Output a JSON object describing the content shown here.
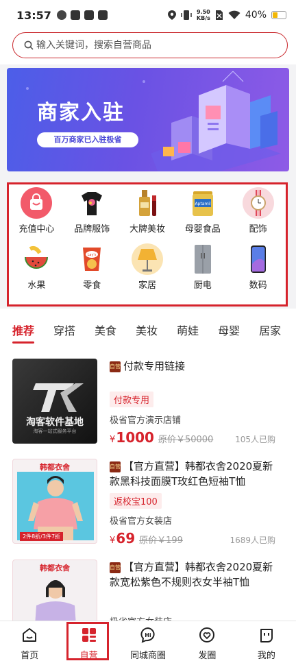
{
  "status_bar": {
    "time": "13:57",
    "speed_top": "9.50",
    "speed_bottom": "KB/s",
    "battery": "40%",
    "battery_level": 0.4
  },
  "search": {
    "placeholder": "输入关键词，搜索自营商品"
  },
  "banner": {
    "title": "商家入驻",
    "subtitle": "百万商家已入驻极省"
  },
  "categories": [
    {
      "label": "充值中心",
      "icon": "shopping-bag-icon",
      "color": "#f25a6a"
    },
    {
      "label": "品牌服饰",
      "icon": "tshirt-icon",
      "color": "#1c1c1c"
    },
    {
      "label": "大牌美妆",
      "icon": "perfume-icon",
      "color": "#d4a23a"
    },
    {
      "label": "母婴食品",
      "icon": "milk-powder-icon",
      "color": "#e7c24b"
    },
    {
      "label": "配饰",
      "icon": "watch-icon",
      "color": "#e1485a"
    },
    {
      "label": "水果",
      "icon": "watermelon-icon",
      "color": "#e24a3c"
    },
    {
      "label": "零食",
      "icon": "chips-icon",
      "color": "#e24a2a"
    },
    {
      "label": "家居",
      "icon": "lamp-icon",
      "color": "#f2b233"
    },
    {
      "label": "厨电",
      "icon": "fridge-icon",
      "color": "#9aa0a8"
    },
    {
      "label": "数码",
      "icon": "phone-icon",
      "color": "#5a7ee6"
    }
  ],
  "tabs": [
    "推荐",
    "穿搭",
    "美食",
    "美妆",
    "萌娃",
    "母婴",
    "居家"
  ],
  "products": [
    {
      "badge": "自营",
      "title": "付款专用链接",
      "tag": "付款专用",
      "shop": "极省官方演示店铺",
      "currency": "¥",
      "price": "1000",
      "orig_price": "原价￥50000",
      "sold": "105人已购",
      "thumb_title": "淘客软件基地",
      "thumb_sub": "淘客一站式服务平台"
    },
    {
      "badge": "自营",
      "title": "【官方直营】韩都衣舍2020夏新款黑科技面膜T玫红色短袖T恤",
      "tag": "返校宝100",
      "shop": "极省官方女装店",
      "currency": "¥",
      "price": "69",
      "orig_price": "原价￥199",
      "sold": "1689人已购",
      "thumb_title": "韩都衣舍",
      "thumb_sub": "2件8折/3件7折"
    },
    {
      "badge": "自营",
      "title": "【官方直营】韩都衣舍2020夏新款宽松紫色不规则衣女半袖T恤",
      "tag": "",
      "shop": "极省官方女装店",
      "currency": "",
      "price": "",
      "orig_price": "",
      "sold": "",
      "thumb_title": "韩都衣舍",
      "thumb_sub": ""
    }
  ],
  "bottom_nav": [
    {
      "label": "首页",
      "icon": "home-icon"
    },
    {
      "label": "自营",
      "icon": "self-operated-icon",
      "active": true
    },
    {
      "label": "同城商圈",
      "icon": "chat-hi-icon"
    },
    {
      "label": "发圈",
      "icon": "heart-share-icon"
    },
    {
      "label": "我的",
      "icon": "profile-face-icon"
    }
  ],
  "colors": {
    "accent": "#d6232c",
    "banner": "#5b57e6"
  }
}
